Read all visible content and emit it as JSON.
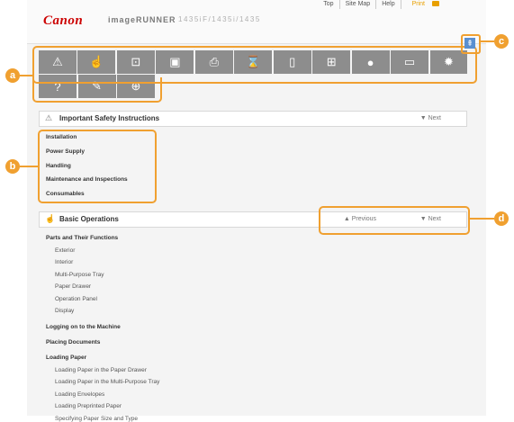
{
  "header": {
    "brand": "Canon",
    "product": "imageRUNNER",
    "model": "1435iF/1435i/1435",
    "toplinks": [
      "Top",
      "Site Map",
      "Help",
      "Print"
    ]
  },
  "callouts": [
    "a",
    "b",
    "c",
    "d"
  ],
  "icons_row1": [
    "warning-icon",
    "hand-icon",
    "tray-icon",
    "copy-icon",
    "printer-icon",
    "scan-icon",
    "mobile-icon",
    "network-icon",
    "lock-icon",
    "monitor-icon",
    "gear-icon"
  ],
  "icons_row2": [
    "help-icon",
    "wrench-icon",
    "plus-icon"
  ],
  "sections": [
    {
      "title": "Important Safety Instructions",
      "next": "Next"
    },
    {
      "title": "Basic Operations",
      "previous": "Previous",
      "next": "Next"
    }
  ],
  "safety_links": [
    "Installation",
    "Power Supply",
    "Handling",
    "Maintenance and Inspections",
    "Consumables"
  ],
  "basic_links": [
    {
      "text": "Parts and Their Functions",
      "level": 0
    },
    {
      "text": "Exterior",
      "level": 1
    },
    {
      "text": "Interior",
      "level": 1
    },
    {
      "text": "Multi-Purpose Tray",
      "level": 1
    },
    {
      "text": "Paper Drawer",
      "level": 1
    },
    {
      "text": "Operation Panel",
      "level": 1
    },
    {
      "text": "Display",
      "level": 1
    },
    {
      "text": "Logging on to the Machine",
      "level": 0
    },
    {
      "text": "Placing Documents",
      "level": 0
    },
    {
      "text": "Loading Paper",
      "level": 0
    },
    {
      "text": "Loading Paper in the Paper Drawer",
      "level": 1
    },
    {
      "text": "Loading Paper in the Multi-Purpose Tray",
      "level": 1
    },
    {
      "text": "Loading Envelopes",
      "level": 1
    },
    {
      "text": "Loading Preprinted Paper",
      "level": 1
    },
    {
      "text": "Specifying Paper Size and Type",
      "level": 1
    }
  ],
  "colors": {
    "accent": "#f0a030",
    "brand": "#cc0000",
    "iconbar": "#8d8d8d"
  }
}
